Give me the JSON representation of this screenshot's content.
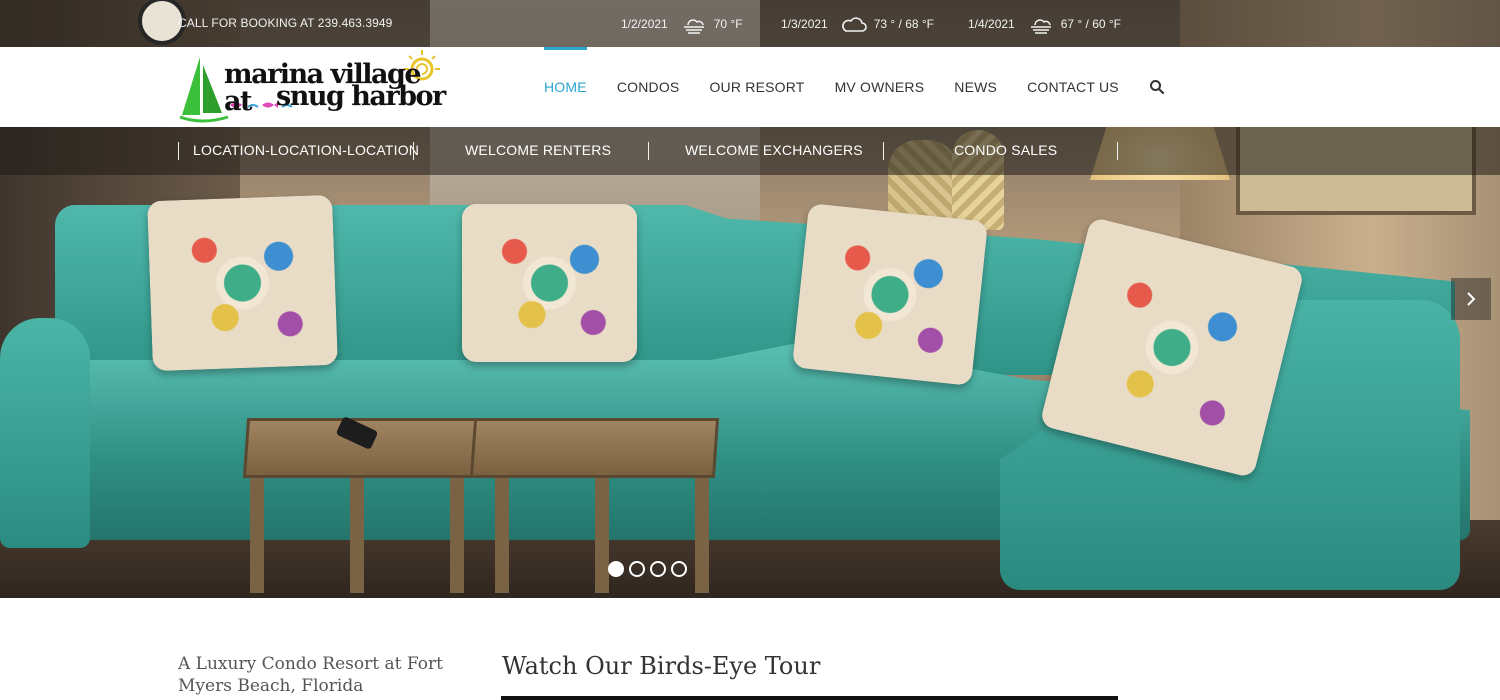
{
  "topbar": {
    "phone_text": "CALL FOR BOOKING AT 239.463.3949",
    "weather": [
      {
        "date": "1/2/2021",
        "temp": "70 °F",
        "icon": "fog-icon"
      },
      {
        "date": "1/3/2021",
        "temp": "73 ° / 68 °F",
        "icon": "cloud-icon"
      },
      {
        "date": "1/4/2021",
        "temp": "67 ° / 60 °F",
        "icon": "fog-icon"
      }
    ]
  },
  "logo": {
    "line1": "marina village at",
    "line2": "snug harbor"
  },
  "nav": {
    "items": [
      "HOME",
      "CONDOS",
      "OUR RESORT",
      "MV OWNERS",
      "NEWS",
      "CONTACT US"
    ],
    "active": "HOME"
  },
  "subnav": {
    "items": [
      "LOCATION-LOCATION-LOCATION",
      "WELCOME RENTERS",
      "WELCOME EXCHANGERS",
      "CONDO SALES"
    ]
  },
  "slider": {
    "slide_count": 4,
    "active_slide": 1
  },
  "content": {
    "tagline": "A Luxury Condo Resort at Fort Myers Beach, Florida",
    "tour_heading": "Watch Our Birds-Eye Tour"
  },
  "colors": {
    "accent": "#2aa6cf"
  }
}
